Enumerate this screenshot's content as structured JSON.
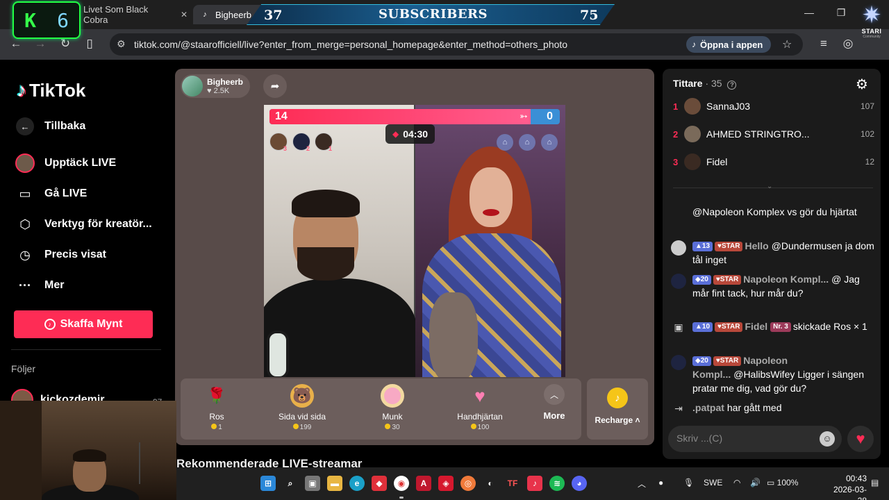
{
  "browser": {
    "tabs": [
      {
        "label": "Livet Som Black Cobra"
      },
      {
        "label": "Bigheerb"
      }
    ],
    "url": "tiktok.com/@staarofficiell/live?enter_from_merge=personal_homepage&enter_method=others_photo",
    "open_app_label": "Öppna i appen"
  },
  "overlay": {
    "k_letter": "K",
    "k_number": "6",
    "sub_left": "37",
    "sub_title": "SUBSCRIBERS",
    "sub_right": "75",
    "logo_text": "STARI",
    "logo_sub": "Community"
  },
  "sidebar": {
    "logo": "TikTok",
    "back_label": "Tillbaka",
    "items": [
      {
        "label": "Upptäck LIVE",
        "icon": "live-avatar-icon"
      },
      {
        "label": "Gå LIVE",
        "icon": "camera-icon"
      },
      {
        "label": "Verktyg för kreatör...",
        "icon": "creator-tools-icon"
      },
      {
        "label": "Precis visat",
        "icon": "history-icon"
      },
      {
        "label": "Mer",
        "icon": "more-dots-icon"
      }
    ],
    "coins_button": "Skaffa Mynt",
    "following_title": "Följer",
    "following_user": {
      "name": "kickozdemir",
      "count": "97"
    }
  },
  "stream": {
    "host_name": "Bigheerb",
    "host_likes": "2.5K",
    "score_left": "14",
    "score_right": "0",
    "score_left_share": 0.9,
    "timer": "04:30",
    "supporter_ranks": [
      "3",
      "2",
      "1"
    ],
    "recommended_title": "Rekommenderade LIVE-streamar"
  },
  "gifts": [
    {
      "name": "Ros",
      "price": "1",
      "icon": "rose-icon"
    },
    {
      "name": "Sida vid sida",
      "price": "199",
      "icon": "side-by-side-icon"
    },
    {
      "name": "Munk",
      "price": "30",
      "icon": "donut-icon"
    },
    {
      "name": "Handhjärtan",
      "price": "100",
      "icon": "hand-hearts-icon"
    }
  ],
  "gift_more_label": "More",
  "recharge_label": "Recharge",
  "chat": {
    "viewers_label": "Tittare",
    "viewers_count": "35",
    "top_viewers": [
      {
        "rank": "1",
        "name": "SannaJ03",
        "score": "107"
      },
      {
        "rank": "2",
        "name": "AHMED STRINGTRO...",
        "score": "102"
      },
      {
        "rank": "3",
        "name": "Fidel",
        "score": "12"
      }
    ],
    "messages": [
      {
        "text": "@Napoleon Komplex vs gör du hjärtat"
      },
      {
        "level": "13",
        "star": "STAR",
        "user": "Hello",
        "text": "@Dundermusen ja dom tål inget"
      },
      {
        "level": "20",
        "star": "STAR",
        "user": "Napoleon Kompl...",
        "text": "@ Jag mår fint tack, hur mår du?"
      },
      {
        "level": "10",
        "star": "STAR",
        "user": "Fidel",
        "nr": "Nr. 3",
        "text": "skickade Ros × 1"
      },
      {
        "level": "20",
        "star": "STAR",
        "user": "Napoleon Kompl...",
        "text": "@HalibsWifey Ligger i sängen pratar me dig, vad gör du?"
      },
      {
        "user": ".patpat",
        "text": "har gått med"
      }
    ],
    "input_placeholder": "Skriv ...(C)"
  },
  "taskbar": {
    "language": "SWE",
    "battery": "100%",
    "time": "00:43",
    "date": "2026-03-28"
  },
  "colors": {
    "tiktok_pink": "#fe2c55",
    "card_bg": "#584b49",
    "chat_bg": "#1b1b1b"
  }
}
